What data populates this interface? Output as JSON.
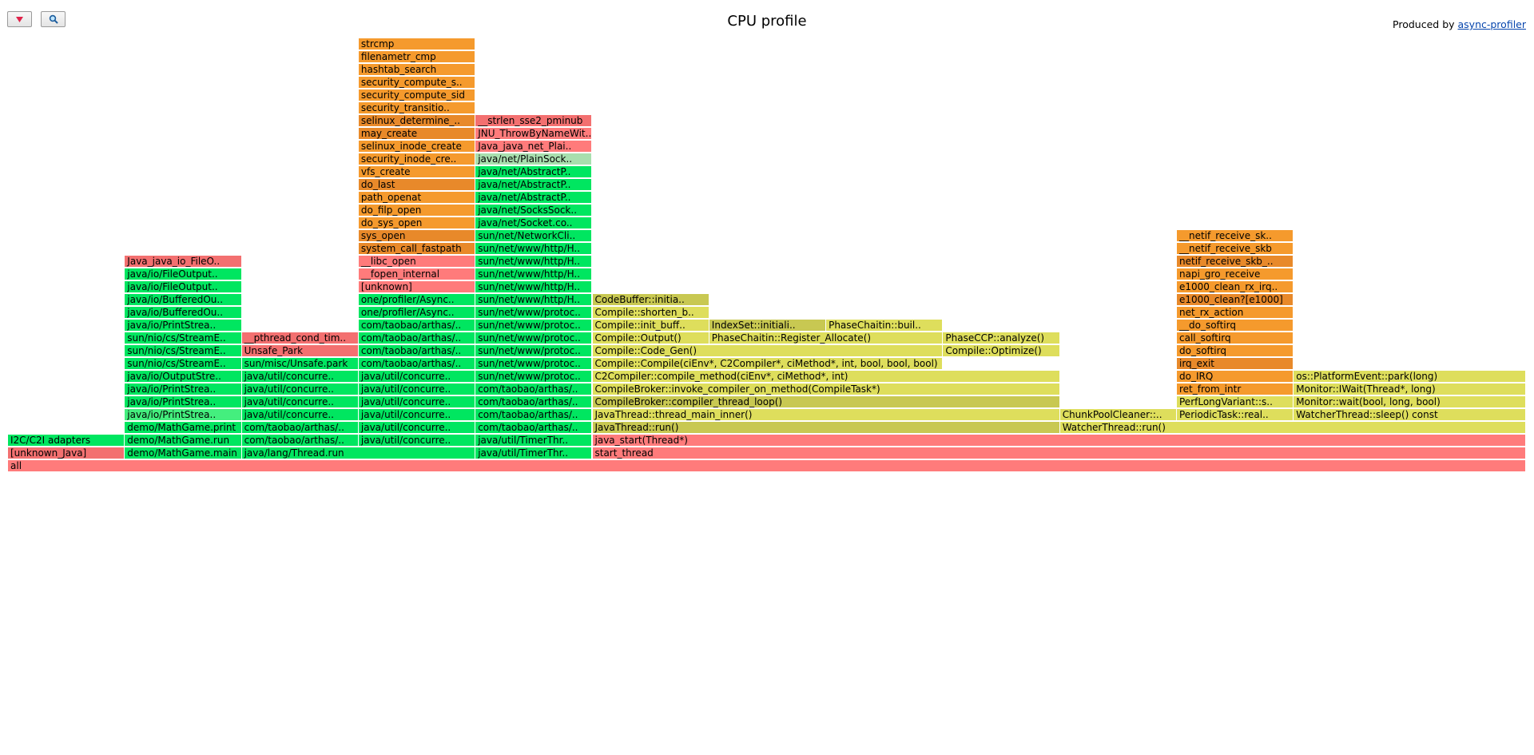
{
  "title": "CPU profile",
  "credit": {
    "prefix": "Produced by ",
    "link_text": "async-profiler"
  },
  "toolbar": {
    "reverse_icon": "triangle-down-icon",
    "search_icon": "magnifier-icon"
  },
  "colors": {
    "java": "#00e660",
    "java_light": "#44ef7e",
    "inlined": "#c8c852",
    "inlined_light": "#dede5c",
    "kernel": "#f59a2d",
    "kernel_dark": "#e8892a",
    "native": "#f37070",
    "native_light": "#ff7b7b",
    "interpreted": "#a8dfae"
  },
  "frames": [
    {
      "d": 0,
      "s": 0,
      "w": 100,
      "name": "all",
      "c": "native_light"
    },
    {
      "d": 1,
      "s": 0,
      "w": 7.7,
      "name": "[unknown_Java]",
      "c": "native"
    },
    {
      "d": 1,
      "s": 7.7,
      "w": 7.7,
      "name": "demo/MathGame.main",
      "c": "java"
    },
    {
      "d": 1,
      "s": 15.4,
      "w": 15.4,
      "name": "java/lang/Thread.run",
      "c": "java"
    },
    {
      "d": 1,
      "s": 30.8,
      "w": 7.7,
      "name": "java/util/TimerThr..",
      "c": "java"
    },
    {
      "d": 1,
      "s": 38.5,
      "w": 61.5,
      "name": "start_thread",
      "c": "native_light"
    },
    {
      "d": 2,
      "s": 0,
      "w": 7.7,
      "name": "I2C/C2I adapters",
      "c": "java"
    },
    {
      "d": 2,
      "s": 7.7,
      "w": 7.7,
      "name": "demo/MathGame.run",
      "c": "java"
    },
    {
      "d": 2,
      "s": 15.4,
      "w": 7.7,
      "name": "com/taobao/arthas/..",
      "c": "java"
    },
    {
      "d": 2,
      "s": 23.1,
      "w": 7.7,
      "name": "java/util/concurre..",
      "c": "java"
    },
    {
      "d": 2,
      "s": 30.8,
      "w": 7.7,
      "name": "java/util/TimerThr..",
      "c": "java"
    },
    {
      "d": 2,
      "s": 38.5,
      "w": 61.5,
      "name": "java_start(Thread*)",
      "c": "native_light"
    },
    {
      "d": 3,
      "s": 7.7,
      "w": 7.7,
      "name": "demo/MathGame.print",
      "c": "java"
    },
    {
      "d": 3,
      "s": 15.4,
      "w": 7.7,
      "name": "com/taobao/arthas/..",
      "c": "java"
    },
    {
      "d": 3,
      "s": 23.1,
      "w": 7.7,
      "name": "java/util/concurre..",
      "c": "java"
    },
    {
      "d": 3,
      "s": 30.8,
      "w": 7.7,
      "name": "com/taobao/arthas/..",
      "c": "java"
    },
    {
      "d": 3,
      "s": 38.5,
      "w": 30.8,
      "name": "JavaThread::run()",
      "c": "inlined"
    },
    {
      "d": 3,
      "s": 69.3,
      "w": 30.7,
      "name": "WatcherThread::run()",
      "c": "inlined_light"
    },
    {
      "d": 4,
      "s": 7.7,
      "w": 7.7,
      "name": "java/io/PrintStrea..",
      "c": "java_light"
    },
    {
      "d": 4,
      "s": 15.4,
      "w": 7.7,
      "name": "java/util/concurre..",
      "c": "java"
    },
    {
      "d": 4,
      "s": 23.1,
      "w": 7.7,
      "name": "java/util/concurre..",
      "c": "java"
    },
    {
      "d": 4,
      "s": 30.8,
      "w": 7.7,
      "name": "com/taobao/arthas/..",
      "c": "java"
    },
    {
      "d": 4,
      "s": 38.5,
      "w": 30.8,
      "name": "JavaThread::thread_main_inner()",
      "c": "inlined_light"
    },
    {
      "d": 4,
      "s": 69.3,
      "w": 7.7,
      "name": "ChunkPoolCleaner::..",
      "c": "inlined_light"
    },
    {
      "d": 4,
      "s": 77.0,
      "w": 7.7,
      "name": "PeriodicTask::real..",
      "c": "inlined_light"
    },
    {
      "d": 4,
      "s": 84.7,
      "w": 15.3,
      "name": "WatcherThread::sleep() const",
      "c": "inlined_light"
    },
    {
      "d": 5,
      "s": 7.7,
      "w": 7.7,
      "name": "java/io/PrintStrea..",
      "c": "java"
    },
    {
      "d": 5,
      "s": 15.4,
      "w": 7.7,
      "name": "java/util/concurre..",
      "c": "java"
    },
    {
      "d": 5,
      "s": 23.1,
      "w": 7.7,
      "name": "java/util/concurre..",
      "c": "java"
    },
    {
      "d": 5,
      "s": 30.8,
      "w": 7.7,
      "name": "com/taobao/arthas/..",
      "c": "java"
    },
    {
      "d": 5,
      "s": 38.5,
      "w": 30.8,
      "name": "CompileBroker::compiler_thread_loop()",
      "c": "inlined"
    },
    {
      "d": 5,
      "s": 77.0,
      "w": 7.7,
      "name": "PerfLongVariant::s..",
      "c": "inlined_light"
    },
    {
      "d": 5,
      "s": 84.7,
      "w": 15.3,
      "name": "Monitor::wait(bool, long, bool)",
      "c": "inlined_light"
    },
    {
      "d": 6,
      "s": 7.7,
      "w": 7.7,
      "name": "java/io/PrintStrea..",
      "c": "java"
    },
    {
      "d": 6,
      "s": 15.4,
      "w": 7.7,
      "name": "java/util/concurre..",
      "c": "java"
    },
    {
      "d": 6,
      "s": 23.1,
      "w": 7.7,
      "name": "java/util/concurre..",
      "c": "java"
    },
    {
      "d": 6,
      "s": 30.8,
      "w": 7.7,
      "name": "com/taobao/arthas/..",
      "c": "java"
    },
    {
      "d": 6,
      "s": 38.5,
      "w": 30.8,
      "name": "CompileBroker::invoke_compiler_on_method(CompileTask*)",
      "c": "inlined_light"
    },
    {
      "d": 6,
      "s": 77.0,
      "w": 7.7,
      "name": "ret_from_intr",
      "c": "kernel"
    },
    {
      "d": 6,
      "s": 84.7,
      "w": 15.3,
      "name": "Monitor::IWait(Thread*, long)",
      "c": "inlined_light"
    },
    {
      "d": 7,
      "s": 7.7,
      "w": 7.7,
      "name": "java/io/OutputStre..",
      "c": "java"
    },
    {
      "d": 7,
      "s": 15.4,
      "w": 7.7,
      "name": "java/util/concurre..",
      "c": "java"
    },
    {
      "d": 7,
      "s": 23.1,
      "w": 7.7,
      "name": "java/util/concurre..",
      "c": "java"
    },
    {
      "d": 7,
      "s": 30.8,
      "w": 7.7,
      "name": "sun/net/www/protoc..",
      "c": "java"
    },
    {
      "d": 7,
      "s": 38.5,
      "w": 30.8,
      "name": "C2Compiler::compile_method(ciEnv*, ciMethod*, int)",
      "c": "inlined_light"
    },
    {
      "d": 7,
      "s": 77.0,
      "w": 7.7,
      "name": "do_IRQ",
      "c": "kernel"
    },
    {
      "d": 7,
      "s": 84.7,
      "w": 15.3,
      "name": "os::PlatformEvent::park(long)",
      "c": "inlined_light"
    },
    {
      "d": 8,
      "s": 7.7,
      "w": 7.7,
      "name": "sun/nio/cs/StreamE..",
      "c": "java"
    },
    {
      "d": 8,
      "s": 15.4,
      "w": 7.7,
      "name": "sun/misc/Unsafe.park",
      "c": "java"
    },
    {
      "d": 8,
      "s": 23.1,
      "w": 7.7,
      "name": "com/taobao/arthas/..",
      "c": "java"
    },
    {
      "d": 8,
      "s": 30.8,
      "w": 7.7,
      "name": "sun/net/www/protoc..",
      "c": "java"
    },
    {
      "d": 8,
      "s": 38.5,
      "w": 23.1,
      "name": "Compile::Compile(ciEnv*, C2Compiler*, ciMethod*, int, bool, bool, bool)",
      "c": "inlined_light"
    },
    {
      "d": 8,
      "s": 77.0,
      "w": 7.7,
      "name": "irq_exit",
      "c": "kernel_dark"
    },
    {
      "d": 9,
      "s": 7.7,
      "w": 7.7,
      "name": "sun/nio/cs/StreamE..",
      "c": "java"
    },
    {
      "d": 9,
      "s": 15.4,
      "w": 7.7,
      "name": "Unsafe_Park",
      "c": "native"
    },
    {
      "d": 9,
      "s": 23.1,
      "w": 7.7,
      "name": "com/taobao/arthas/..",
      "c": "java"
    },
    {
      "d": 9,
      "s": 30.8,
      "w": 7.7,
      "name": "sun/net/www/protoc..",
      "c": "java"
    },
    {
      "d": 9,
      "s": 38.5,
      "w": 23.1,
      "name": "Compile::Code_Gen()",
      "c": "inlined_light"
    },
    {
      "d": 9,
      "s": 61.6,
      "w": 7.7,
      "name": "Compile::Optimize()",
      "c": "inlined_light"
    },
    {
      "d": 9,
      "s": 77.0,
      "w": 7.7,
      "name": "do_softirq",
      "c": "kernel"
    },
    {
      "d": 10,
      "s": 7.7,
      "w": 7.7,
      "name": "sun/nio/cs/StreamE..",
      "c": "java"
    },
    {
      "d": 10,
      "s": 15.4,
      "w": 7.7,
      "name": "__pthread_cond_tim..",
      "c": "native"
    },
    {
      "d": 10,
      "s": 23.1,
      "w": 7.7,
      "name": "com/taobao/arthas/..",
      "c": "java"
    },
    {
      "d": 10,
      "s": 30.8,
      "w": 7.7,
      "name": "sun/net/www/protoc..",
      "c": "java"
    },
    {
      "d": 10,
      "s": 38.5,
      "w": 7.7,
      "name": "Compile::Output()",
      "c": "inlined_light"
    },
    {
      "d": 10,
      "s": 46.2,
      "w": 15.4,
      "name": "PhaseChaitin::Register_Allocate()",
      "c": "inlined_light"
    },
    {
      "d": 10,
      "s": 61.6,
      "w": 7.7,
      "name": "PhaseCCP::analyze()",
      "c": "inlined_light"
    },
    {
      "d": 10,
      "s": 77.0,
      "w": 7.7,
      "name": "call_softirq",
      "c": "kernel"
    },
    {
      "d": 11,
      "s": 7.7,
      "w": 7.7,
      "name": "java/io/PrintStrea..",
      "c": "java"
    },
    {
      "d": 11,
      "s": 23.1,
      "w": 7.7,
      "name": "com/taobao/arthas/..",
      "c": "java"
    },
    {
      "d": 11,
      "s": 30.8,
      "w": 7.7,
      "name": "sun/net/www/protoc..",
      "c": "java"
    },
    {
      "d": 11,
      "s": 38.5,
      "w": 7.7,
      "name": "Compile::init_buff..",
      "c": "inlined_light"
    },
    {
      "d": 11,
      "s": 46.2,
      "w": 7.7,
      "name": "IndexSet::initiali..",
      "c": "inlined"
    },
    {
      "d": 11,
      "s": 53.9,
      "w": 7.7,
      "name": "PhaseChaitin::buil..",
      "c": "inlined_light"
    },
    {
      "d": 11,
      "s": 77.0,
      "w": 7.7,
      "name": "__do_softirq",
      "c": "kernel"
    },
    {
      "d": 12,
      "s": 7.7,
      "w": 7.7,
      "name": "java/io/BufferedOu..",
      "c": "java"
    },
    {
      "d": 12,
      "s": 23.1,
      "w": 7.7,
      "name": "one/profiler/Async..",
      "c": "java"
    },
    {
      "d": 12,
      "s": 30.8,
      "w": 7.7,
      "name": "sun/net/www/protoc..",
      "c": "java"
    },
    {
      "d": 12,
      "s": 38.5,
      "w": 7.7,
      "name": "Compile::shorten_b..",
      "c": "inlined_light"
    },
    {
      "d": 12,
      "s": 77.0,
      "w": 7.7,
      "name": "net_rx_action",
      "c": "kernel"
    },
    {
      "d": 13,
      "s": 7.7,
      "w": 7.7,
      "name": "java/io/BufferedOu..",
      "c": "java"
    },
    {
      "d": 13,
      "s": 23.1,
      "w": 7.7,
      "name": "one/profiler/Async..",
      "c": "java"
    },
    {
      "d": 13,
      "s": 30.8,
      "w": 7.7,
      "name": "sun/net/www/http/H..",
      "c": "java"
    },
    {
      "d": 13,
      "s": 38.5,
      "w": 7.7,
      "name": "CodeBuffer::initia..",
      "c": "inlined"
    },
    {
      "d": 13,
      "s": 77.0,
      "w": 7.7,
      "name": "e1000_clean?[e1000]",
      "c": "kernel_dark"
    },
    {
      "d": 14,
      "s": 7.7,
      "w": 7.7,
      "name": "java/io/FileOutput..",
      "c": "java"
    },
    {
      "d": 14,
      "s": 23.1,
      "w": 7.7,
      "name": "[unknown]",
      "c": "native_light"
    },
    {
      "d": 14,
      "s": 30.8,
      "w": 7.7,
      "name": "sun/net/www/http/H..",
      "c": "java"
    },
    {
      "d": 14,
      "s": 77.0,
      "w": 7.7,
      "name": "e1000_clean_rx_irq..",
      "c": "kernel"
    },
    {
      "d": 15,
      "s": 7.7,
      "w": 7.7,
      "name": "java/io/FileOutput..",
      "c": "java"
    },
    {
      "d": 15,
      "s": 23.1,
      "w": 7.7,
      "name": "__fopen_internal",
      "c": "native_light"
    },
    {
      "d": 15,
      "s": 30.8,
      "w": 7.7,
      "name": "sun/net/www/http/H..",
      "c": "java"
    },
    {
      "d": 15,
      "s": 77.0,
      "w": 7.7,
      "name": "napi_gro_receive",
      "c": "kernel"
    },
    {
      "d": 16,
      "s": 7.7,
      "w": 7.7,
      "name": "Java_java_io_FileO..",
      "c": "native"
    },
    {
      "d": 16,
      "s": 23.1,
      "w": 7.7,
      "name": "__libc_open",
      "c": "native_light"
    },
    {
      "d": 16,
      "s": 30.8,
      "w": 7.7,
      "name": "sun/net/www/http/H..",
      "c": "java"
    },
    {
      "d": 16,
      "s": 77.0,
      "w": 7.7,
      "name": "netif_receive_skb_..",
      "c": "kernel_dark"
    },
    {
      "d": 17,
      "s": 23.1,
      "w": 7.7,
      "name": "system_call_fastpath",
      "c": "kernel_dark"
    },
    {
      "d": 17,
      "s": 30.8,
      "w": 7.7,
      "name": "sun/net/www/http/H..",
      "c": "java"
    },
    {
      "d": 17,
      "s": 77.0,
      "w": 7.7,
      "name": "__netif_receive_skb",
      "c": "kernel"
    },
    {
      "d": 18,
      "s": 23.1,
      "w": 7.7,
      "name": "sys_open",
      "c": "kernel_dark"
    },
    {
      "d": 18,
      "s": 30.8,
      "w": 7.7,
      "name": "sun/net/NetworkCli..",
      "c": "java"
    },
    {
      "d": 18,
      "s": 77.0,
      "w": 7.7,
      "name": "__netif_receive_sk..",
      "c": "kernel"
    },
    {
      "d": 19,
      "s": 23.1,
      "w": 7.7,
      "name": "do_sys_open",
      "c": "kernel"
    },
    {
      "d": 19,
      "s": 30.8,
      "w": 7.7,
      "name": "java/net/Socket.co..",
      "c": "java"
    },
    {
      "d": 20,
      "s": 23.1,
      "w": 7.7,
      "name": "do_filp_open",
      "c": "kernel"
    },
    {
      "d": 20,
      "s": 30.8,
      "w": 7.7,
      "name": "java/net/SocksSock..",
      "c": "java"
    },
    {
      "d": 21,
      "s": 23.1,
      "w": 7.7,
      "name": "path_openat",
      "c": "kernel"
    },
    {
      "d": 21,
      "s": 30.8,
      "w": 7.7,
      "name": "java/net/AbstractP..",
      "c": "java"
    },
    {
      "d": 22,
      "s": 23.1,
      "w": 7.7,
      "name": "do_last",
      "c": "kernel_dark"
    },
    {
      "d": 22,
      "s": 30.8,
      "w": 7.7,
      "name": "java/net/AbstractP..",
      "c": "java"
    },
    {
      "d": 23,
      "s": 23.1,
      "w": 7.7,
      "name": "vfs_create",
      "c": "kernel"
    },
    {
      "d": 23,
      "s": 30.8,
      "w": 7.7,
      "name": "java/net/AbstractP..",
      "c": "java"
    },
    {
      "d": 24,
      "s": 23.1,
      "w": 7.7,
      "name": "security_inode_cre..",
      "c": "kernel"
    },
    {
      "d": 24,
      "s": 30.8,
      "w": 7.7,
      "name": "java/net/PlainSock..",
      "c": "interpreted"
    },
    {
      "d": 25,
      "s": 23.1,
      "w": 7.7,
      "name": "selinux_inode_create",
      "c": "kernel"
    },
    {
      "d": 25,
      "s": 30.8,
      "w": 7.7,
      "name": "Java_java_net_Plai..",
      "c": "native_light"
    },
    {
      "d": 26,
      "s": 23.1,
      "w": 7.7,
      "name": "may_create",
      "c": "kernel_dark"
    },
    {
      "d": 26,
      "s": 30.8,
      "w": 7.7,
      "name": "JNU_ThrowByNameWit..",
      "c": "native_light"
    },
    {
      "d": 27,
      "s": 23.1,
      "w": 7.7,
      "name": "selinux_determine_..",
      "c": "kernel_dark"
    },
    {
      "d": 27,
      "s": 30.8,
      "w": 7.7,
      "name": "__strlen_sse2_pminub",
      "c": "native"
    },
    {
      "d": 28,
      "s": 23.1,
      "w": 7.7,
      "name": "security_transitio..",
      "c": "kernel"
    },
    {
      "d": 29,
      "s": 23.1,
      "w": 7.7,
      "name": "security_compute_sid",
      "c": "kernel"
    },
    {
      "d": 30,
      "s": 23.1,
      "w": 7.7,
      "name": "security_compute_s..",
      "c": "kernel"
    },
    {
      "d": 31,
      "s": 23.1,
      "w": 7.7,
      "name": "hashtab_search",
      "c": "kernel"
    },
    {
      "d": 32,
      "s": 23.1,
      "w": 7.7,
      "name": "filenametr_cmp",
      "c": "kernel"
    },
    {
      "d": 33,
      "s": 23.1,
      "w": 7.7,
      "name": "strcmp",
      "c": "kernel"
    }
  ]
}
